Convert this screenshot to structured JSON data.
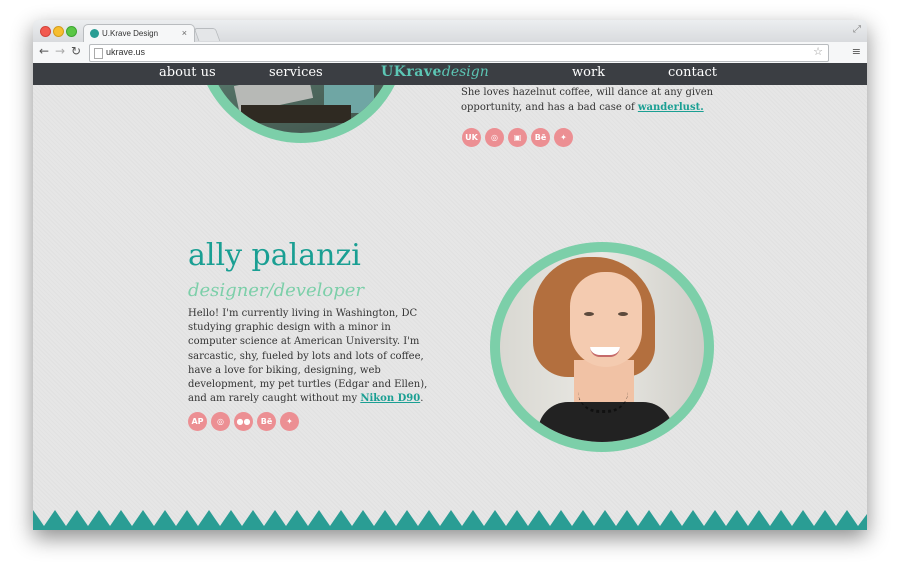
{
  "browser": {
    "tab_title": "U.Krave Design",
    "tab_close": "×",
    "back": "←",
    "forward": "→",
    "reload": "↻",
    "url": "ukrave.us",
    "star": "☆",
    "menu": "≡",
    "resize": "⤢"
  },
  "site_nav": {
    "items": [
      "about us",
      "services",
      "work",
      "contact"
    ],
    "logo_main": "UKrave",
    "logo_sub": "design"
  },
  "top_profile": {
    "bio_prefix": "She loves hazelnut coffee, will dance at any given opportunity, and has a bad case of ",
    "bio_link": "wanderlust.",
    "social_icons": [
      "tumblr-like-icon",
      "dribbble-icon",
      "instagram-icon",
      "behance-icon",
      "twitter-icon"
    ],
    "social_glyphs": [
      "UK",
      "◎",
      "▣",
      "Bē",
      "✦"
    ]
  },
  "profile": {
    "name": "ally palanzi",
    "role": "designer/developer",
    "bio_prefix": "Hello! I'm currently living in Washington, DC studying graphic design with a minor in computer science at American University. I'm sarcastic, shy, fueled by lots and lots of coffee, have a love for biking, designing, web development, my pet turtles (Edgar and Ellen), and am rarely caught without my ",
    "bio_link": "Nikon D90",
    "bio_suffix": ".",
    "social_icons": [
      "ap-icon",
      "dribbble-icon",
      "flickr-icon",
      "behance-icon",
      "twitter-icon"
    ],
    "social_glyphs": [
      "AP",
      "◎",
      "●●",
      "Bē",
      "✦"
    ]
  },
  "colors": {
    "teal": "#1a9f93",
    "mint": "#7ccfa9",
    "pink": "#ec8f93",
    "nav_bg": "#3b3e43"
  }
}
